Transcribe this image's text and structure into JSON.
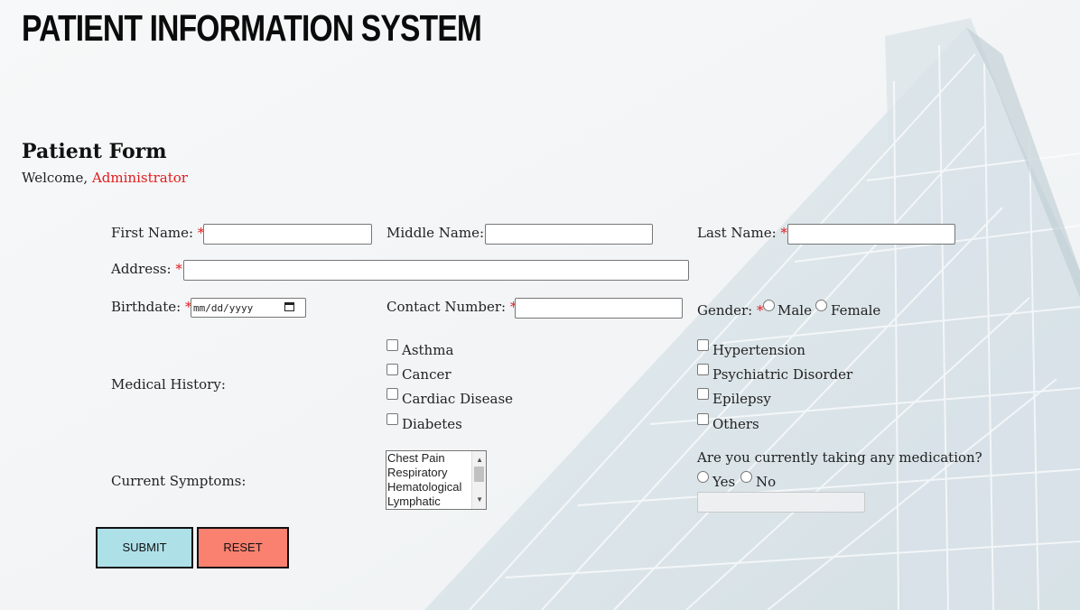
{
  "app": {
    "title": "PATIENT INFORMATION SYSTEM"
  },
  "form": {
    "heading": "Patient Form",
    "welcome_prefix": "Welcome,",
    "user_name": "Administrator",
    "required_mark": "*",
    "fields": {
      "first_name": {
        "label": "First Name:",
        "value": ""
      },
      "middle_name": {
        "label": "Middle Name:",
        "value": ""
      },
      "last_name": {
        "label": "Last Name:",
        "value": ""
      },
      "address": {
        "label": "Address:",
        "value": ""
      },
      "birthdate": {
        "label": "Birthdate:",
        "placeholder": "mm/dd/yyyy"
      },
      "contact_number": {
        "label": "Contact Number:",
        "value": ""
      },
      "gender": {
        "label": "Gender:",
        "options": [
          "Male",
          "Female"
        ]
      }
    },
    "medical_history": {
      "label": "Medical History:",
      "options": [
        "Asthma",
        "Cancer",
        "Cardiac Disease",
        "Diabetes",
        "Hypertension",
        "Psychiatric Disorder",
        "Epilepsy",
        "Others"
      ]
    },
    "current_symptoms": {
      "label": "Current Symptoms:",
      "options": [
        "Chest Pain",
        "Respiratory",
        "Hematological",
        "Lymphatic"
      ]
    },
    "medication": {
      "question": "Are you currently taking any medication?",
      "options": [
        "Yes",
        "No"
      ],
      "details_value": ""
    },
    "buttons": {
      "submit": "SUBMIT",
      "reset": "RESET"
    }
  },
  "colors": {
    "required": "#e21b1b",
    "submit_bg": "#aee0e8",
    "reset_bg": "#fa8070"
  },
  "icons": {
    "birthdate_picker": "calendar-icon"
  }
}
